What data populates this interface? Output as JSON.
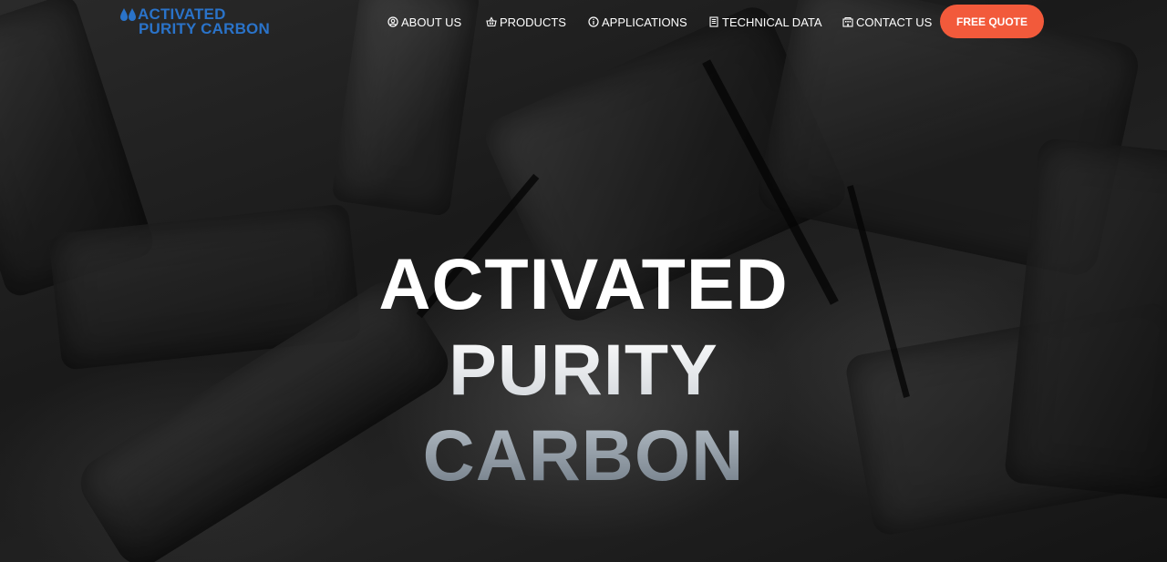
{
  "brand": {
    "name_line1": "ACTIVATED",
    "name_line2": "PURITY CARBON",
    "color": "#2a73c9"
  },
  "nav": {
    "items": [
      {
        "label": "ABOUT US",
        "icon": "user-circle-icon"
      },
      {
        "label": "PRODUCTS",
        "icon": "basket-icon"
      },
      {
        "label": "APPLICATIONS",
        "icon": "info-circle-icon"
      },
      {
        "label": "TECHNICAL DATA",
        "icon": "document-icon"
      },
      {
        "label": "CONTACT US",
        "icon": "building-icon"
      }
    ],
    "cta_label": "FREE QUOTE",
    "cta_color": "#f25a3b"
  },
  "hero": {
    "line1": "ACTIVATED",
    "line2": "PURITY",
    "line3": "CARBON"
  }
}
